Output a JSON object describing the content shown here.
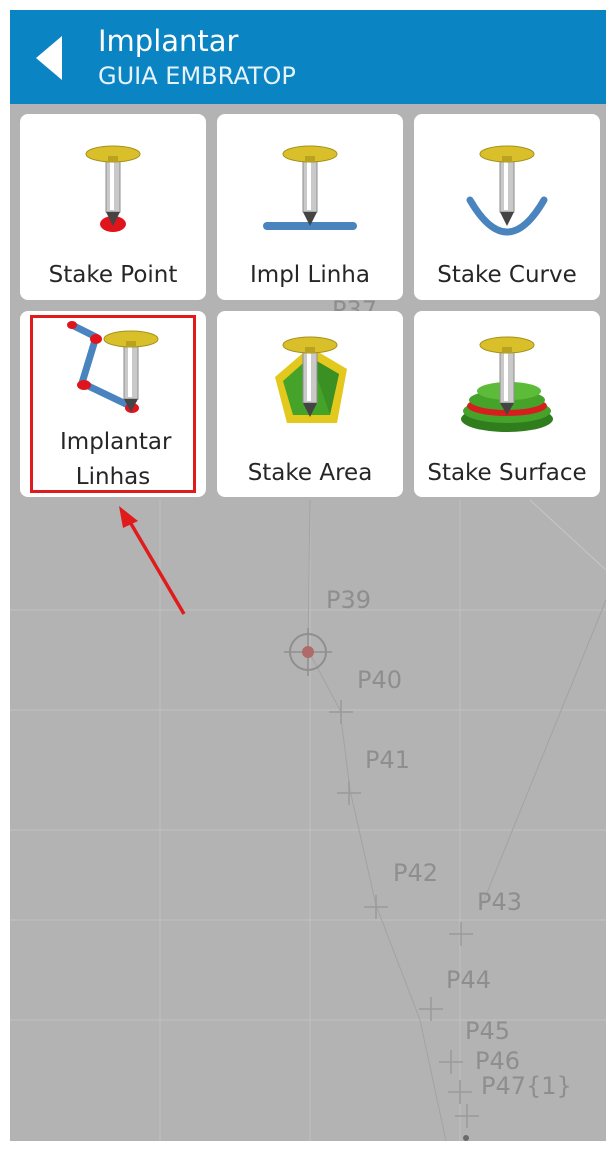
{
  "header": {
    "title": "Implantar",
    "subtitle": "GUIA EMBRATOP",
    "back_icon": "back-arrow-icon"
  },
  "tiles": [
    {
      "label": "Stake Point",
      "icon": "stake-point-icon"
    },
    {
      "label": "Impl Linha",
      "icon": "stake-line-icon"
    },
    {
      "label": "Stake Curve",
      "icon": "stake-curve-icon"
    },
    {
      "label": "Implantar Linhas",
      "icon": "stake-polyline-icon",
      "highlighted": true
    },
    {
      "label": "Stake Area",
      "icon": "stake-area-icon"
    },
    {
      "label": "Stake Surface",
      "icon": "stake-surface-icon"
    }
  ],
  "map": {
    "points": [
      "P37",
      "P39",
      "P40",
      "P41",
      "P42",
      "P43",
      "P44",
      "P45",
      "P46",
      "P47{1}"
    ]
  },
  "colors": {
    "header": "#0b84c4",
    "highlight": "#e01b1b",
    "map_bg": "#b3b3b3"
  }
}
